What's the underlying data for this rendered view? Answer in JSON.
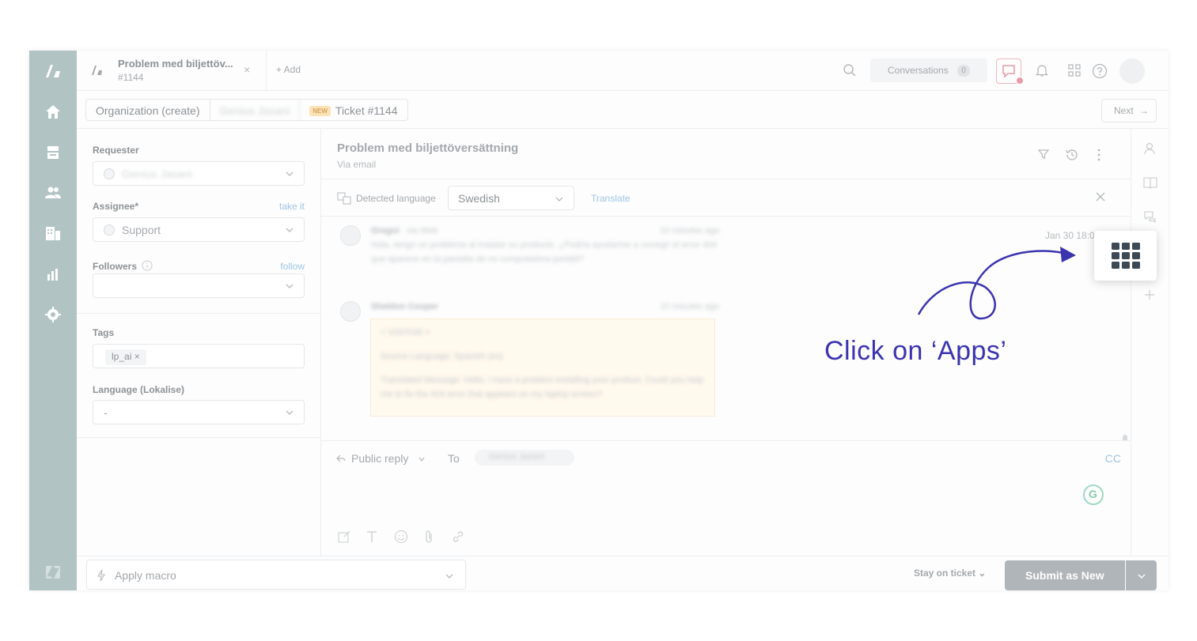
{
  "header": {
    "tab_title": "Problem med biljettöv...",
    "tab_subtitle": "#1144",
    "tab_close": "×",
    "add_tab_label": "+ Add",
    "conversations_label": "Conversations",
    "conversations_count": "0"
  },
  "breadcrumb": {
    "items": [
      "Organization (create)",
      "Genius Jasani",
      "Ticket #1144"
    ],
    "new_badge": "NEW",
    "next_label": "Next"
  },
  "sidebar": {
    "requester_label": "Requester",
    "requester_value": "Genius Jasani",
    "assignee_label": "Assignee*",
    "assignee_link": "take it",
    "assignee_value": "Support",
    "followers_label": "Followers",
    "followers_link": "follow",
    "tags_label": "Tags",
    "tag_value": "lp_ai",
    "language_label": "Language (Lokalise)",
    "language_value": "-"
  },
  "ticket": {
    "title": "Problem med biljettöversättning",
    "via": "Via email",
    "detected_language_label": "Detected language",
    "detected_language_value": "Swedish",
    "translate_label": "Translate",
    "timestamp": "Jan 30 18:0"
  },
  "conversation": {
    "msg1_author": "Gregor",
    "msg1_meta": "via Web",
    "msg1_time": "10 minutes ago",
    "msg1_body": "Hola, tengo un problema al instalar su producto. ¿Podría ayudarme a corregir el error 404 que aparece en la pantalla de mi computadora portátil?",
    "msg2_author": "Sheldon Cooper",
    "msg2_time": "10 minutes ago",
    "msg2_quote_head": "< VISITOR >",
    "msg2_quote_lang": "Source Language: Spanish (es)",
    "msg2_quote_body": "Translated Message: Hello, I have a problem installing your product. Could you help me to fix the 404 error that appears on my laptop screen?"
  },
  "reply": {
    "mode_label": "Public reply",
    "to_label": "To",
    "to_value": "Genius Jasani",
    "cc_label": "CC",
    "grammarly_label": "G"
  },
  "footer": {
    "macro_label": "Apply macro",
    "stay_label": "Stay on ticket",
    "submit_label": "Submit as New"
  },
  "annotation": {
    "text": "Click on ‘Apps’",
    "color": "#3b34b0"
  }
}
